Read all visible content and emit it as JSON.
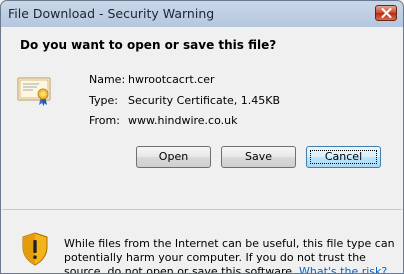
{
  "window": {
    "title": "File Download - Security Warning"
  },
  "dialog": {
    "question": "Do you want to open or save this file?",
    "file": {
      "name_label": "Name:",
      "name_value": "hwrootcacrt.cer",
      "type_label": "Type:",
      "type_value": "Security Certificate, 1.45KB",
      "from_label": "From:",
      "from_value": "www.hindwire.co.uk"
    },
    "buttons": {
      "open": "Open",
      "save": "Save",
      "cancel": "Cancel"
    },
    "warning": {
      "text": "While files from the Internet can be useful, this file type can potentially harm your computer. If you do not trust the source, do not open or save this software.",
      "link": "What's the risk?"
    }
  },
  "icons": {
    "certificate": "certificate-icon",
    "shield": "shield-warning-icon",
    "close": "close-icon"
  }
}
